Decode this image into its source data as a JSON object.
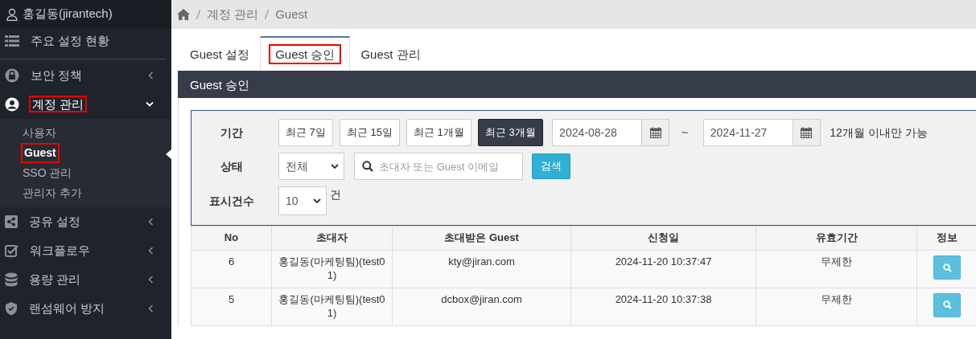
{
  "sidebar": {
    "user": "홍길동(jirantech)",
    "dashboard_link": {
      "label": "주요 설정 현황"
    },
    "menus": [
      {
        "label": "보안 정책",
        "expanded": false,
        "highlighted": false
      },
      {
        "label": "계정 관리",
        "expanded": true,
        "highlighted": true,
        "children": [
          {
            "label": "사용자",
            "selected": false,
            "highlighted": false
          },
          {
            "label": "Guest",
            "selected": true,
            "highlighted": true
          },
          {
            "label": "SSO 관리",
            "selected": false,
            "highlighted": false
          },
          {
            "label": "관리자 추가",
            "selected": false,
            "highlighted": false
          }
        ]
      },
      {
        "label": "공유 설정",
        "expanded": false,
        "highlighted": false
      },
      {
        "label": "워크플로우",
        "expanded": false,
        "highlighted": false
      },
      {
        "label": "용량 관리",
        "expanded": false,
        "highlighted": false
      },
      {
        "label": "랜섬웨어 방지",
        "expanded": false,
        "highlighted": false
      }
    ]
  },
  "breadcrumb": [
    "계정 관리",
    "Guest"
  ],
  "tabs": [
    {
      "label": "Guest 설정",
      "selected": false,
      "highlighted": false
    },
    {
      "label": "Guest 승인",
      "selected": true,
      "highlighted": true
    },
    {
      "label": "Guest 관리",
      "selected": false,
      "highlighted": false
    }
  ],
  "panel": {
    "title": "Guest 승인",
    "filter": {
      "period_label": "기간",
      "periods": [
        {
          "label": "최근 7일",
          "selected": false
        },
        {
          "label": "최근 15일",
          "selected": false
        },
        {
          "label": "최근 1개월",
          "selected": false
        },
        {
          "label": "최근 3개월",
          "selected": true
        }
      ],
      "date_from": "2024-08-28",
      "separator": "~",
      "date_to": "2024-11-27",
      "note": "12개월 이내만 가능",
      "status_label": "상태",
      "status_value": "전체",
      "search": {
        "placeholder": "초대자 또는 Guest 이메일"
      },
      "search_button": "검색",
      "count_label": "표시건수",
      "count_value": "10",
      "count_unit": "건"
    },
    "table": {
      "columns": [
        "No",
        "초대자",
        "초대받은 Guest",
        "신청일",
        "유효기간",
        "정보"
      ],
      "rows": [
        {
          "no": "6",
          "inviter": "홍길동(마케팅팀)(test01)",
          "guest": "kty@jiran.com",
          "requested": "2024-11-20 10:37:47",
          "validity": "무제한"
        },
        {
          "no": "5",
          "inviter": "홍길동(마케팅팀)(test01)",
          "guest": "dcbox@jiran.com",
          "requested": "2024-11-20 10:37:38",
          "validity": "무제한"
        }
      ]
    }
  }
}
